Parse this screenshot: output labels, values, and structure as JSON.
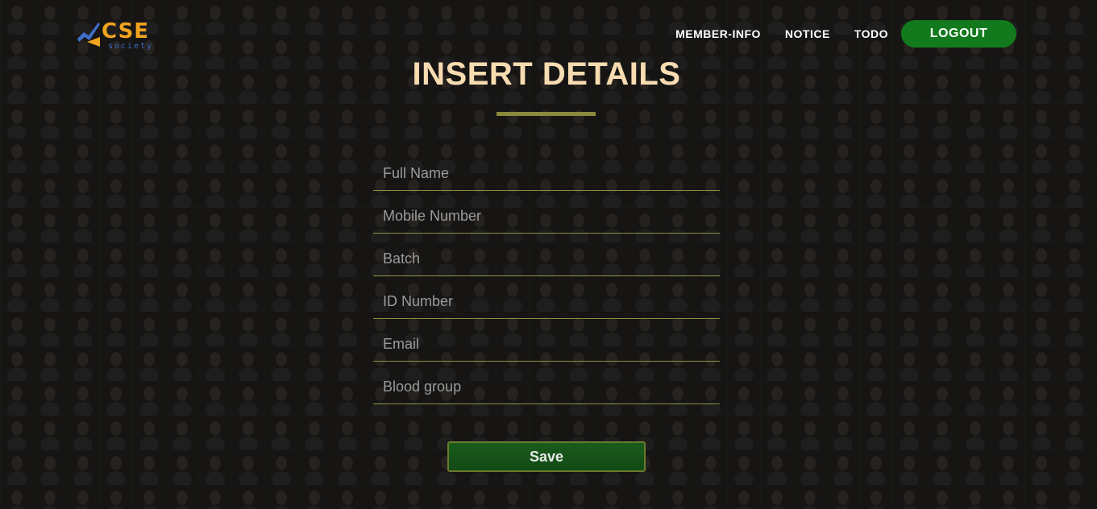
{
  "logo": {
    "text": "CSE",
    "subtext": "society",
    "colors": {
      "primary": "#f0a320",
      "secondary": "#3f6fc9"
    }
  },
  "nav": {
    "links": [
      "MEMBER-INFO",
      "NOTICE",
      "TODO"
    ],
    "logout_label": "LOGOUT",
    "logout_color": "#127a1c"
  },
  "page": {
    "title": "INSERT DETAILS",
    "title_color": "#f8dcb1",
    "underline_color": "#8a8a3c"
  },
  "form": {
    "fields": [
      {
        "placeholder": "Full Name",
        "value": ""
      },
      {
        "placeholder": "Mobile Number",
        "value": ""
      },
      {
        "placeholder": "Batch",
        "value": ""
      },
      {
        "placeholder": "ID Number",
        "value": ""
      },
      {
        "placeholder": "Email",
        "value": ""
      },
      {
        "placeholder": "Blood group",
        "value": ""
      }
    ],
    "save_label": "Save",
    "save_color": "#1a5c1c"
  }
}
